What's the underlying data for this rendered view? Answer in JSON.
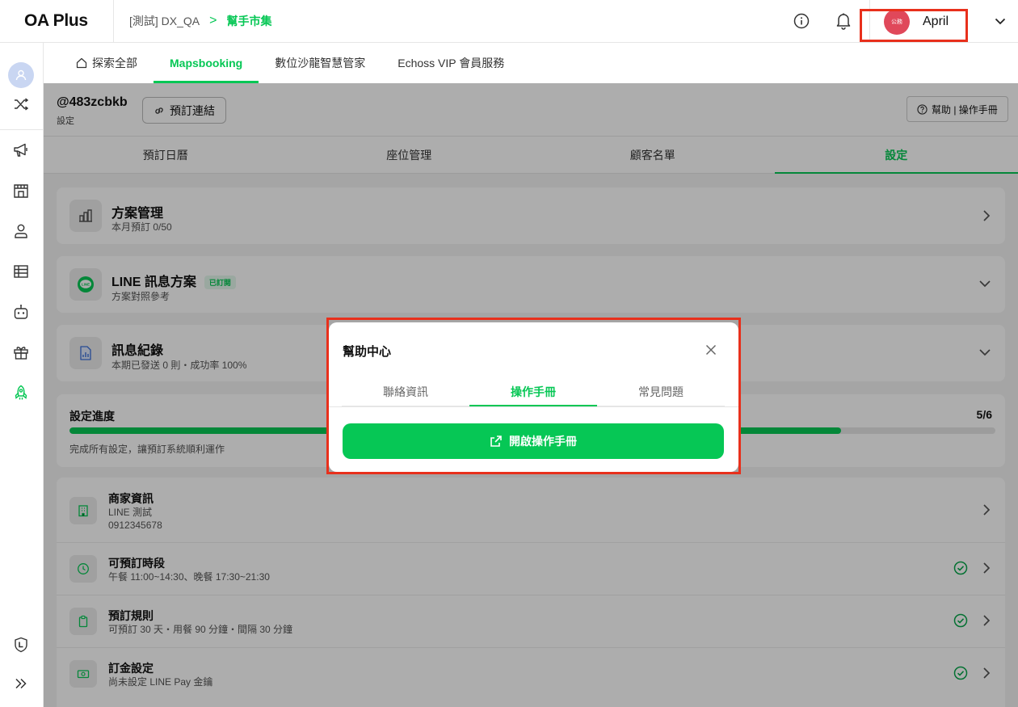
{
  "app": {
    "logo": "OA Plus"
  },
  "breadcrumb": {
    "account": "[測試] DX_QA",
    "separator": ">",
    "current": "幫手市集"
  },
  "user": {
    "avatar_text": "公務",
    "name": "April"
  },
  "main_tabs": [
    {
      "label": "探索全部"
    },
    {
      "label": "Mapsbooking"
    },
    {
      "label": "數位沙龍智慧管家"
    },
    {
      "label": "Echoss VIP 會員服務"
    }
  ],
  "account_bar": {
    "id": "@483zcbkb",
    "sub": "設定",
    "link_button": "預訂連結",
    "help_button": "幫助 | 操作手冊"
  },
  "sub_tabs": [
    {
      "label": "預訂日曆"
    },
    {
      "label": "座位管理"
    },
    {
      "label": "顧客名單"
    },
    {
      "label": "設定"
    }
  ],
  "plan_card": {
    "title": "方案管理",
    "sub": "本月預訂 0/50"
  },
  "line_card": {
    "title": "LINE 訊息方案",
    "badge": "已訂閱",
    "sub": "方案對照參考",
    "icon_text": "LINE"
  },
  "message_card": {
    "title": "訊息紀錄",
    "sub": "本期已發送 0 則・成功率 100%"
  },
  "progress": {
    "title": "設定進度",
    "count": "5/6",
    "value": 0.8333,
    "hint": "完成所有設定，讓預訂系統順利運作"
  },
  "settings_list": [
    {
      "title": "商家資訊",
      "sub1": "LINE 測試",
      "sub2": "0912345678",
      "checked": false
    },
    {
      "title": "可預訂時段",
      "sub1": "午餐 11:00~14:30、晚餐 17:30~21:30",
      "checked": true
    },
    {
      "title": "預訂規則",
      "sub1": "可預訂 30 天・用餐 90 分鐘・間隔 30 分鐘",
      "checked": true
    },
    {
      "title": "訂金設定",
      "sub1": "尚未設定 LINE Pay 金鑰",
      "checked": true
    }
  ],
  "modal": {
    "title": "幫助中心",
    "tabs": [
      {
        "label": "聯絡資訊"
      },
      {
        "label": "操作手冊"
      },
      {
        "label": "常見問題"
      }
    ],
    "open_button": "開啟操作手冊"
  },
  "colors": {
    "brand": "#06c755",
    "highlight": "#e8301c"
  }
}
